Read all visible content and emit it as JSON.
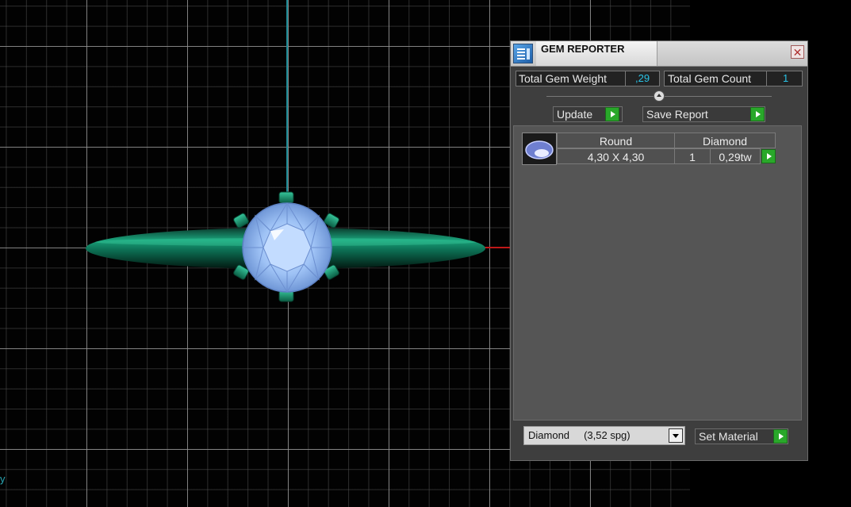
{
  "viewport": {
    "axis_label": "y"
  },
  "panel": {
    "title": "GEM REPORTER",
    "icons": {
      "app": "report-icon",
      "close": "close-icon"
    },
    "close_glyph": "✕",
    "total_weight_label": "Total Gem Weight",
    "total_weight_value": ",29",
    "total_count_label": "Total Gem Count",
    "total_count_value": "1",
    "update_label": "Update",
    "save_report_label": "Save Report",
    "report": {
      "rows": [
        {
          "shape": "Round",
          "size": "4,30 X 4,30",
          "material": "Diamond",
          "count": "1",
          "weight": "0,29tw"
        }
      ]
    },
    "material_select": "Diamond     (3,52 spg)",
    "set_material_label": "Set Material"
  },
  "colors": {
    "accent_value": "#29c3e6",
    "go_button": "#29a82a",
    "gem": "#8fb8f5",
    "metal": "#0e7a5a"
  }
}
